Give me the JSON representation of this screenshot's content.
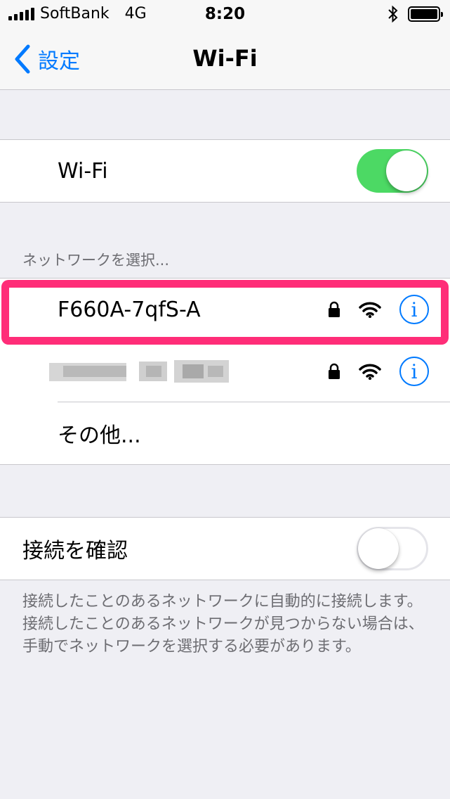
{
  "status_bar": {
    "carrier": "SoftBank",
    "network": "4G",
    "time": "8:20",
    "icons": [
      "signal-icon",
      "bluetooth-icon",
      "battery-icon"
    ]
  },
  "nav": {
    "back_label": "設定",
    "title": "Wi-Fi"
  },
  "wifi_toggle": {
    "label": "Wi-Fi",
    "on": true
  },
  "networks": {
    "header": "ネットワークを選択...",
    "items": [
      {
        "name": "F660A-7qfS-A",
        "secured": true,
        "highlighted": true
      },
      {
        "name": "",
        "secured": true,
        "blurred": true
      }
    ],
    "other_label": "その他..."
  },
  "ask_to_join": {
    "label": "接続を確認",
    "on": false,
    "footer": "接続したことのあるネットワークに自動的に接続します。接続したことのあるネットワークが見つからない場合は、手動でネットワークを選択する必要があります。"
  },
  "colors": {
    "accent": "#007aff",
    "toggle_on": "#4cd964",
    "highlight": "#ff2d78",
    "background": "#efeff4"
  }
}
